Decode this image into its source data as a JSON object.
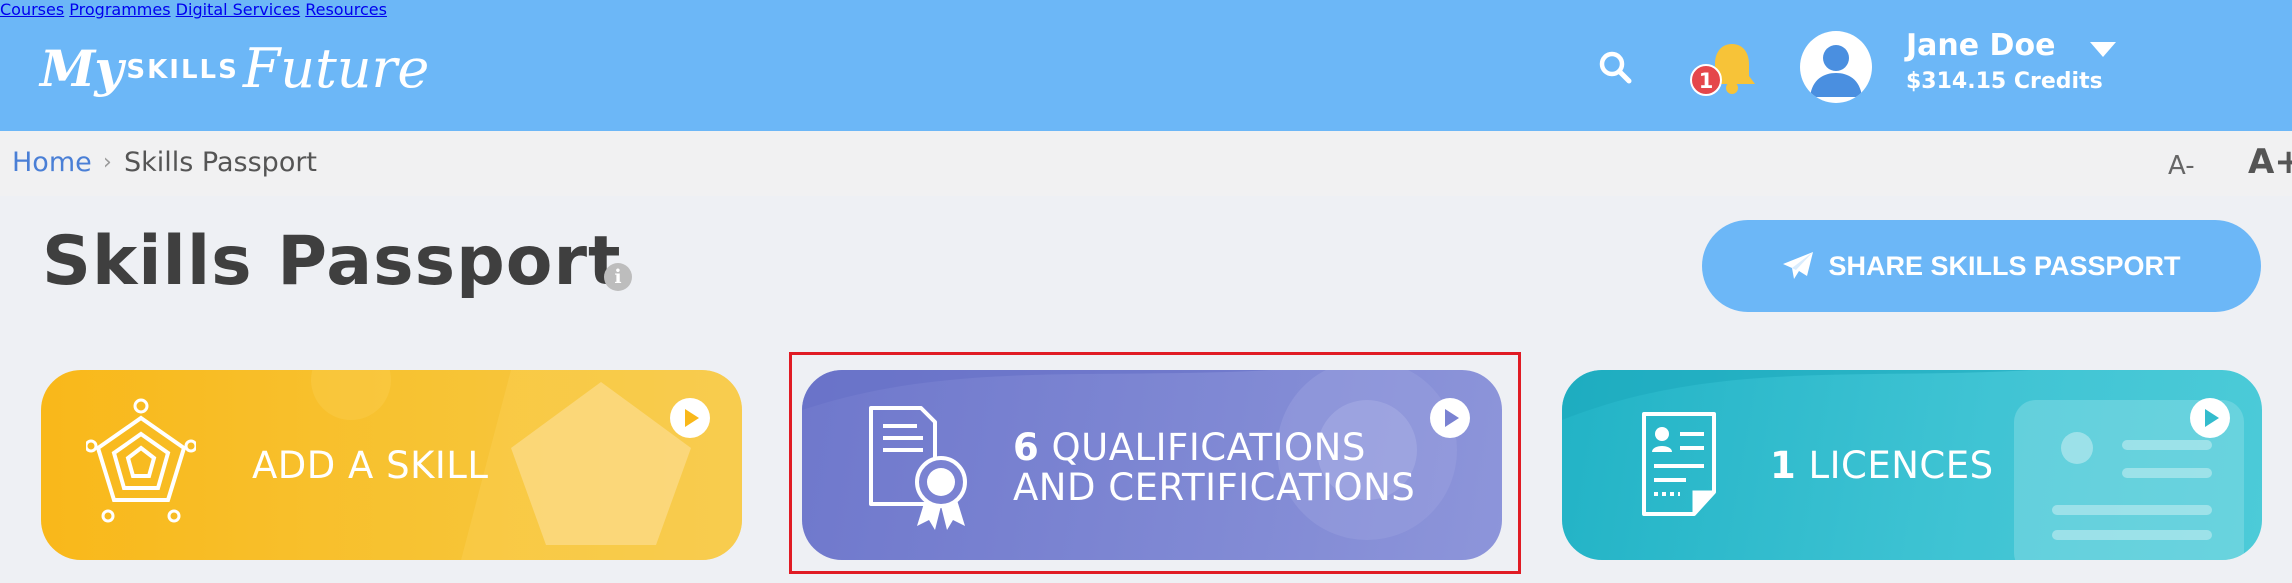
{
  "header": {
    "logo": {
      "my": "My",
      "skills": "SKILLS",
      "future": "Future"
    },
    "nav": [
      "Courses",
      "Programmes",
      "Digital Services",
      "Resources"
    ],
    "notification_count": "1",
    "user": {
      "name": "Jane Doe",
      "credits": "$314.15 Credits"
    }
  },
  "breadcrumb": {
    "home": "Home",
    "separator": "›",
    "current": "Skills Passport"
  },
  "font_controls": {
    "decrease": "A-",
    "increase": "A+"
  },
  "page": {
    "title": "Skills Passport",
    "info_glyph": "i",
    "share_button": "SHARE SKILLS PASSPORT"
  },
  "cards": [
    {
      "id": "skill",
      "count": "",
      "line1": "ADD A SKILL",
      "line2": ""
    },
    {
      "id": "qualifications",
      "count": "6",
      "line1": "QUALIFICATIONS",
      "line2": "AND CERTIFICATIONS"
    },
    {
      "id": "licences",
      "count": "1",
      "line1": "LICENCES",
      "line2": ""
    }
  ],
  "colors": {
    "header_bg": "#6cb7f7",
    "skill_card": "#f9b81a",
    "qualifications_card": "#7a82d2",
    "licences_card": "#33bccd",
    "highlight_border": "#e01b24",
    "notification_badge": "#e5474b",
    "bell": "#f7c338"
  },
  "icons": {
    "search": "search-icon",
    "bell": "bell-icon",
    "avatar": "user-avatar-icon",
    "share": "paper-plane-icon",
    "skill": "radar-chart-icon",
    "qualification": "certificate-icon",
    "licence": "document-icon",
    "play": "play-icon"
  }
}
